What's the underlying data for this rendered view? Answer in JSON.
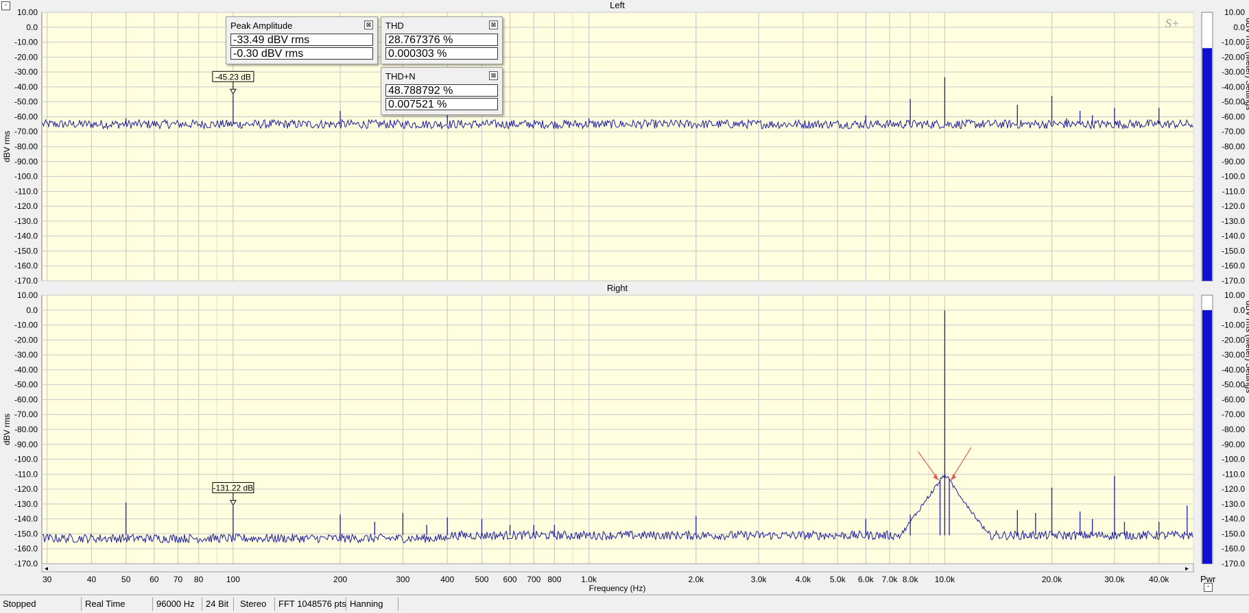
{
  "chart_data": [
    {
      "type": "line",
      "title": "Left",
      "xlabel": "",
      "ylabel": "dBV rms",
      "xscale": "log",
      "xlim": [
        29,
        50000
      ],
      "ylim": [
        -170,
        10
      ],
      "x_tick_labels": [
        "30",
        "40",
        "50",
        "60",
        "70",
        "80",
        "100",
        "200",
        "300",
        "400",
        "500",
        "600",
        "700",
        "800",
        "1.0k",
        "2.0k",
        "3.0k",
        "4.0k",
        "5.0k",
        "6.0k",
        "7.0k",
        "8.0k",
        "10.0k",
        "20.0k",
        "30.0k",
        "40.0k"
      ],
      "y_tick_labels": [
        "10.00",
        "0.0",
        "-10.00",
        "-20.00",
        "-30.00",
        "-40.00",
        "-50.00",
        "-60.00",
        "-70.00",
        "-80.00",
        "-90.00",
        "-100.0",
        "-110.0",
        "-120.0",
        "-130.0",
        "-140.0",
        "-150.0",
        "-160.0",
        "-170.0"
      ],
      "noise_floor_db": -65,
      "peaks": [
        {
          "x": 50,
          "y": -61
        },
        {
          "x": 100,
          "y": -45.23
        },
        {
          "x": 200,
          "y": -56
        },
        {
          "x": 400,
          "y": -59
        },
        {
          "x": 1000,
          "y": -61
        },
        {
          "x": 6000,
          "y": -59
        },
        {
          "x": 8000,
          "y": -48
        },
        {
          "x": 10000,
          "y": -33.49
        },
        {
          "x": 16000,
          "y": -52
        },
        {
          "x": 20000,
          "y": -46
        },
        {
          "x": 22000,
          "y": -61
        },
        {
          "x": 24000,
          "y": -56
        },
        {
          "x": 26000,
          "y": -59
        },
        {
          "x": 30000,
          "y": -54
        },
        {
          "x": 40000,
          "y": -54
        }
      ],
      "marker": {
        "x": 100,
        "label": "-45.23 dB"
      },
      "color": "#1a1aa0",
      "level_meter": {
        "value_db": -14,
        "color": "#1010d0"
      }
    },
    {
      "type": "line",
      "title": "Right",
      "xlabel": "Frequency (Hz)",
      "ylabel": "dBV rms",
      "xscale": "log",
      "xlim": [
        29,
        50000
      ],
      "ylim": [
        -170,
        10
      ],
      "x_tick_labels": [
        "30",
        "40",
        "50",
        "60",
        "70",
        "80",
        "100",
        "200",
        "300",
        "400",
        "500",
        "600",
        "700",
        "800",
        "1.0k",
        "2.0k",
        "3.0k",
        "4.0k",
        "5.0k",
        "6.0k",
        "7.0k",
        "8.0k",
        "10.0k",
        "20.0k",
        "30.0k",
        "40.0k"
      ],
      "y_tick_labels": [
        "10.00",
        "0.0",
        "-10.00",
        "-20.00",
        "-30.00",
        "-40.00",
        "-50.00",
        "-60.00",
        "-70.00",
        "-80.00",
        "-90.00",
        "-100.0",
        "-110.0",
        "-120.0",
        "-130.0",
        "-140.0",
        "-150.0",
        "-160.0",
        "-170.0"
      ],
      "noise_floor_db": -151,
      "peaks": [
        {
          "x": 50,
          "y": -129
        },
        {
          "x": 100,
          "y": -131.22
        },
        {
          "x": 200,
          "y": -137
        },
        {
          "x": 250,
          "y": -142
        },
        {
          "x": 300,
          "y": -136
        },
        {
          "x": 350,
          "y": -144
        },
        {
          "x": 400,
          "y": -139
        },
        {
          "x": 500,
          "y": -140
        },
        {
          "x": 600,
          "y": -144
        },
        {
          "x": 700,
          "y": -144
        },
        {
          "x": 800,
          "y": -144
        },
        {
          "x": 2000,
          "y": -138
        },
        {
          "x": 6000,
          "y": -140
        },
        {
          "x": 8000,
          "y": -137
        },
        {
          "x": 9700,
          "y": -114
        },
        {
          "x": 10000,
          "y": -0.3
        },
        {
          "x": 10300,
          "y": -113
        },
        {
          "x": 16000,
          "y": -134
        },
        {
          "x": 18000,
          "y": -136
        },
        {
          "x": 20000,
          "y": -119
        },
        {
          "x": 24000,
          "y": -135
        },
        {
          "x": 26000,
          "y": -140
        },
        {
          "x": 30000,
          "y": -111
        },
        {
          "x": 32000,
          "y": -142
        },
        {
          "x": 40000,
          "y": -142
        },
        {
          "x": 48000,
          "y": -131
        }
      ],
      "marker": {
        "x": 100,
        "label": "-131.22 dB"
      },
      "color": "#1a1aa0",
      "level_meter": {
        "value_db": 0,
        "color": "#1010d0"
      }
    }
  ],
  "boxes": {
    "peak": {
      "title": "Peak Amplitude",
      "v1": "-33.49 dBV rms",
      "v2": " -0.30 dBV rms",
      "close": "⊠"
    },
    "thd": {
      "title": "THD",
      "v1": "28.767376 %",
      "v2": "0.000303 %",
      "close": "⊠"
    },
    "thdn": {
      "title": "THD+N",
      "v1": "48.788792 %",
      "v2": "0.007521 %",
      "close": "⊠"
    }
  },
  "meter_label": "Pwr",
  "meter_axis_label": "dBV rms (Meter) Settings",
  "logo": "S+",
  "status": {
    "state": "Stopped",
    "mode": "Real Time",
    "rate": "96000 Hz",
    "bits": "24 Bit",
    "channels": "Stereo",
    "fft": "FFT 1048576 pts",
    "window": "Hanning"
  },
  "colors": {
    "plot_bg": "#ffffe0",
    "grid": "#c8c8c8",
    "trace": "#1a1aa0",
    "meter": "#1010d0",
    "arrow": "#e06060"
  }
}
